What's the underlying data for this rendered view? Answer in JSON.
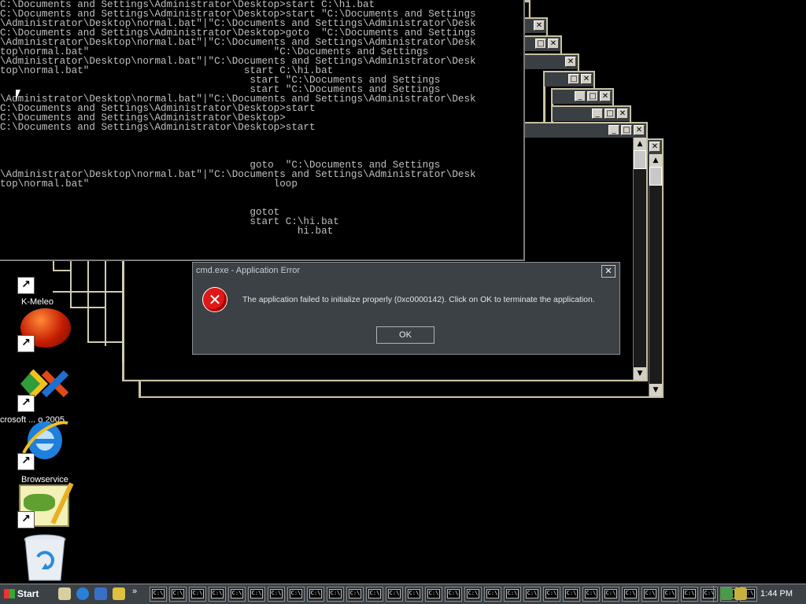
{
  "console": {
    "lines": [
      "C:\\Documents and Settings\\Administrator\\Desktop>start C:\\hi.bat",
      "C:\\Documents and Settings\\Administrator\\Desktop>start \"C:\\Documents and Settings",
      "\\Administrator\\Desktop\\normal.bat\"|\"C:\\Documents and Settings\\Administrator\\Desk",
      "C:\\Documents and Settings\\Administrator\\Desktop>goto  \"C:\\Documents and Settings",
      "\\Administrator\\Desktop\\normal.bat\"|\"C:\\Documents and Settings\\Administrator\\Desk",
      "top\\normal.bat\"                               \"C:\\Documents and Settings",
      "\\Administrator\\Desktop\\normal.bat\"|\"C:\\Documents and Settings\\Administrator\\Desk",
      "top\\normal.bat\"                          start C:\\hi.bat",
      "                                          start \"C:\\Documents and Settings",
      "                                          start \"C:\\Documents and Settings",
      "\\Administrator\\Desktop\\normal.bat\"|\"C:\\Documents and Settings\\Administrator\\Desk",
      "C:\\Documents and Settings\\Administrator\\Desktop>start",
      "C:\\Documents and Settings\\Administrator\\Desktop>",
      "C:\\Documents and Settings\\Administrator\\Desktop>start",
      "",
      "",
      "",
      "                                          goto  \"C:\\Documents and Settings",
      "\\Administrator\\Desktop\\normal.bat\"|\"C:\\Documents and Settings\\Administrator\\Desk",
      "top\\normal.bat\"                               loop",
      "",
      "",
      "                                          gotot",
      "                                          start C:\\hi.bat",
      "                                                  hi.bat"
    ]
  },
  "desktop_icons": [
    {
      "label": "K-Meleo",
      "icon": "k-meleon-icon"
    },
    {
      "label": "",
      "icon": "red-ball-icon"
    },
    {
      "label": "crosoft ... o 2005",
      "icon": "visual-studio-icon"
    },
    {
      "label": "Browservice",
      "icon": "internet-explorer-icon"
    },
    {
      "label": "",
      "icon": "notepad-pencil-icon"
    },
    {
      "label": "",
      "icon": "recycle-bin-icon"
    }
  ],
  "dialog": {
    "title": "cmd.exe - Application Error",
    "message": "The application failed to initialize properly (0xc0000142). Click on OK to terminate the application.",
    "ok_label": "OK",
    "close_glyph": "✕",
    "error_glyph": "✕"
  },
  "window_buttons": {
    "min": "_",
    "max": "□",
    "close": "✕"
  },
  "taskbar": {
    "start_label": "Start",
    "task_glyph": "C:\\",
    "task_count": 31,
    "chevron": "»",
    "clock": "1:44 PM"
  },
  "colors": {
    "dialog_bg": "#3c4146",
    "taskbar_bg": "#3c4146",
    "console_text": "#c0c0c0",
    "frame_border": "#c7c1a0",
    "error_red": "#e01818"
  }
}
